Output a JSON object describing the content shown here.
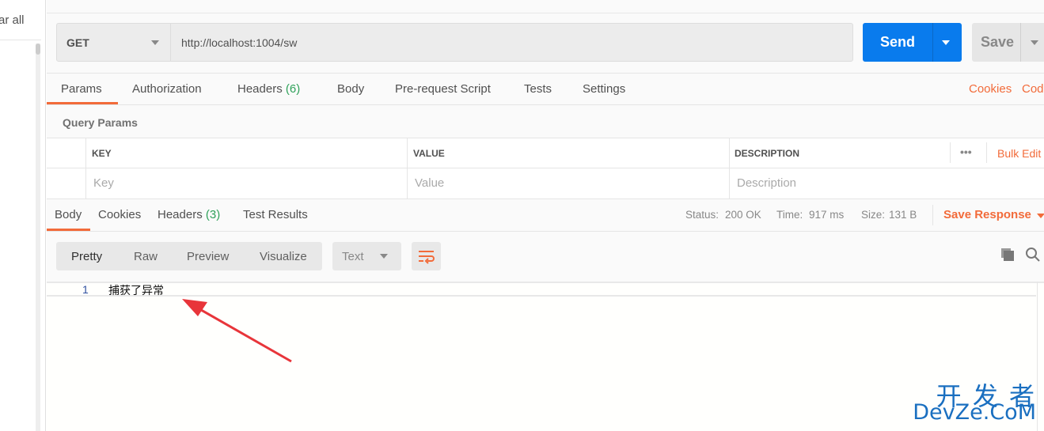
{
  "sidebar": {
    "clear_all": "ar all"
  },
  "request": {
    "method": "GET",
    "url": "http://localhost:1004/sw",
    "send": "Send",
    "save": "Save"
  },
  "tabs": [
    {
      "label": "Params"
    },
    {
      "label": "Authorization"
    },
    {
      "label": "Headers",
      "count": "(6)"
    },
    {
      "label": "Body"
    },
    {
      "label": "Pre-request Script"
    },
    {
      "label": "Tests"
    },
    {
      "label": "Settings"
    }
  ],
  "links": {
    "cookies": "Cookies",
    "code": "Code"
  },
  "query_params": {
    "title": "Query Params",
    "columns": [
      "KEY",
      "VALUE",
      "DESCRIPTION"
    ],
    "placeholders": [
      "Key",
      "Value",
      "Description"
    ],
    "bulk_edit": "Bulk Edit",
    "more": "•••"
  },
  "response": {
    "tabs": [
      {
        "label": "Body"
      },
      {
        "label": "Cookies"
      },
      {
        "label": "Headers",
        "count": "(3)"
      },
      {
        "label": "Test Results"
      }
    ],
    "status_label": "Status:",
    "status": "200 OK",
    "time_label": "Time:",
    "time": "917 ms",
    "size_label": "Size:",
    "size": "131 B",
    "save_response": "Save Response",
    "views": [
      "Pretty",
      "Raw",
      "Preview",
      "Visualize"
    ],
    "format": "Text",
    "lines": [
      {
        "n": "1",
        "text": "捕获了异常"
      }
    ]
  },
  "watermark": {
    "top": "开 发 者",
    "bottom": "DevZe.CoM"
  },
  "colors": {
    "accent": "#f26b3a",
    "send": "#097bed",
    "success": "#2fa15a"
  }
}
